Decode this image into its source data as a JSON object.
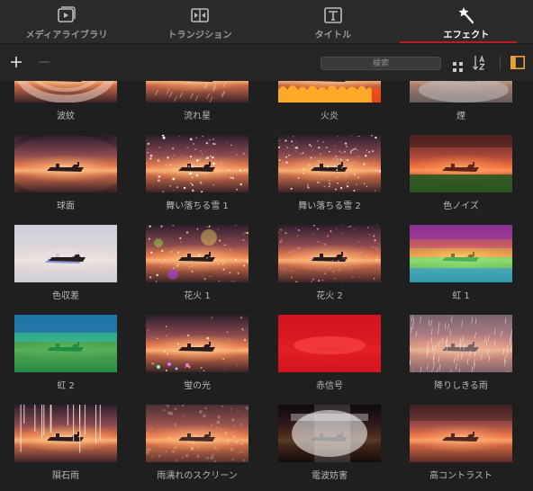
{
  "tabs": [
    {
      "id": "media",
      "label": "メディアライブラリ",
      "icon": "media-library-icon",
      "active": false
    },
    {
      "id": "transition",
      "label": "トランジション",
      "icon": "transition-icon",
      "active": false
    },
    {
      "id": "title",
      "label": "タイトル",
      "icon": "title-icon",
      "active": false
    },
    {
      "id": "effect",
      "label": "エフェクト",
      "icon": "effect-wand-icon",
      "active": true
    }
  ],
  "accent_color": "#c21a22",
  "toolbar": {
    "add_icon": "plus-icon",
    "remove_icon": "minus-icon",
    "search_placeholder": "検索",
    "view_icon": "grid-view-icon",
    "sort_icon": "sort-az-icon",
    "panel_icon": "panel-toggle-icon",
    "panel_icon_color": "#e8a23a"
  },
  "effects": [
    {
      "label": "波紋",
      "effect": "ripple"
    },
    {
      "label": "流れ星",
      "effect": "shooting-star"
    },
    {
      "label": "火炎",
      "effect": "flame"
    },
    {
      "label": "煙",
      "effect": "smoke"
    },
    {
      "label": "球面",
      "effect": "sphere"
    },
    {
      "label": "舞い落ちる雪 1",
      "effect": "snow1"
    },
    {
      "label": "舞い落ちる雪 2",
      "effect": "snow2"
    },
    {
      "label": "色ノイズ",
      "effect": "color-noise"
    },
    {
      "label": "色収差",
      "effect": "chromatic"
    },
    {
      "label": "花火 1",
      "effect": "fireworks1"
    },
    {
      "label": "花火 2",
      "effect": "fireworks2"
    },
    {
      "label": "虹 1",
      "effect": "rainbow1"
    },
    {
      "label": "虹 2",
      "effect": "rainbow2"
    },
    {
      "label": "蛍の光",
      "effect": "firefly"
    },
    {
      "label": "赤信号",
      "effect": "red-signal"
    },
    {
      "label": "降りしきる雨",
      "effect": "heavy-rain"
    },
    {
      "label": "隕石雨",
      "effect": "meteor-rain"
    },
    {
      "label": "雨濡れのスクリーン",
      "effect": "wet-screen"
    },
    {
      "label": "電波妨害",
      "effect": "interference"
    },
    {
      "label": "高コントラスト",
      "effect": "high-contrast"
    }
  ]
}
